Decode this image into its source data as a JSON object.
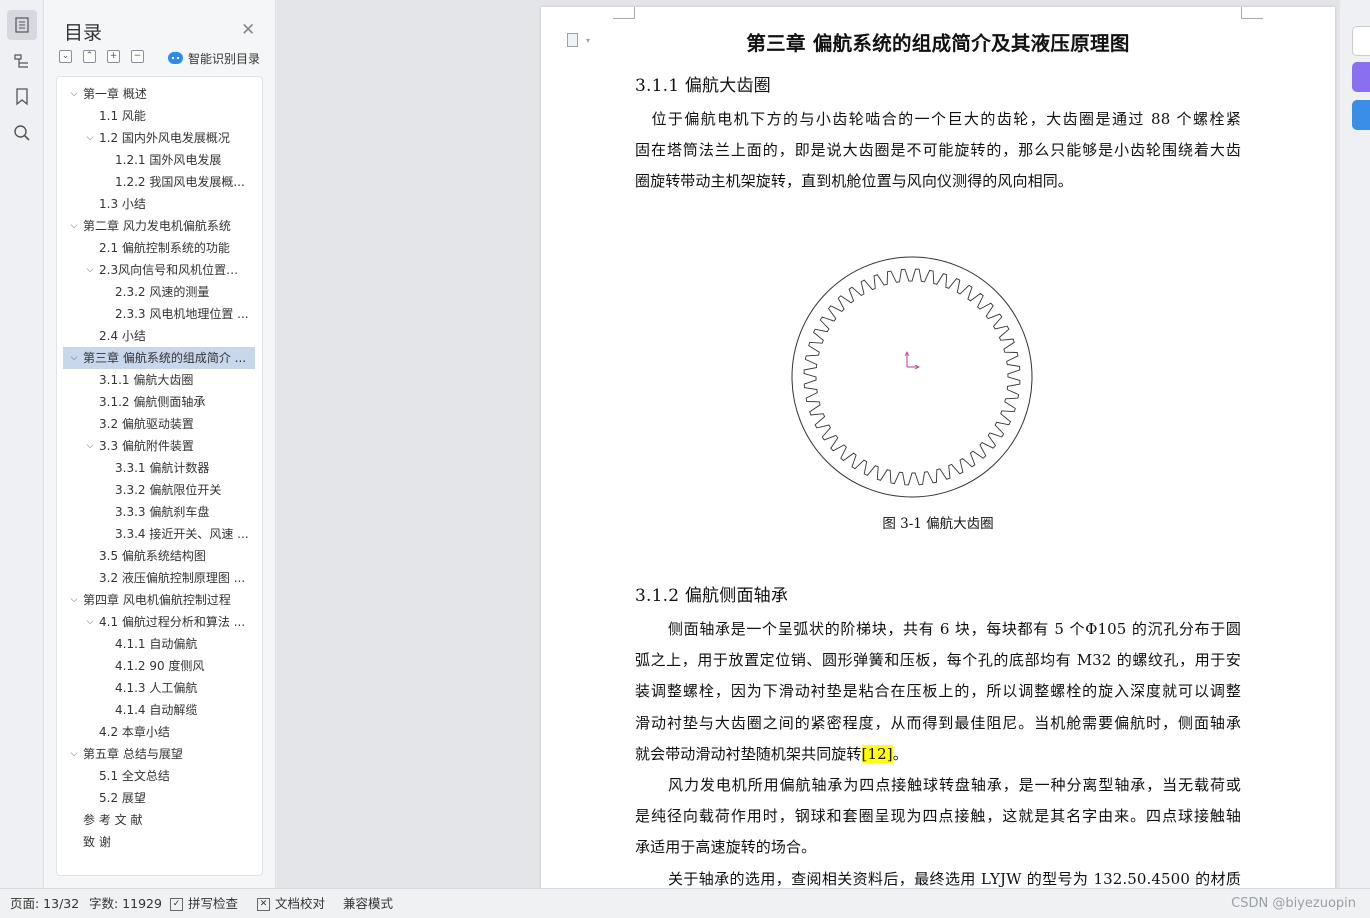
{
  "nav": {
    "title": "目录",
    "smart_toc_label": "智能识别目录",
    "toc": [
      {
        "label": "第一章  概述",
        "level": 0,
        "arrow": "down"
      },
      {
        "label": "1.1  风能",
        "level": 1
      },
      {
        "label": "1.2  国内外风电发展概况",
        "level": 1,
        "arrow": "down"
      },
      {
        "label": "1.2.1  国外风电发展",
        "level": 2
      },
      {
        "label": "1.2.2  我国风电发展概...",
        "level": 2
      },
      {
        "label": "1.3  小结",
        "level": 1
      },
      {
        "label": "第二章  风力发电机偏航系统",
        "level": 0,
        "arrow": "down"
      },
      {
        "label": "2.1 偏航控制系统的功能",
        "level": 1
      },
      {
        "label": "2.3风向信号和风机位置对 ...",
        "level": 1,
        "arrow": "down"
      },
      {
        "label": "2.3.2 风速的测量",
        "level": 2
      },
      {
        "label": "2.3.3  风电机地理位置 ...",
        "level": 2
      },
      {
        "label": "2.4 小结",
        "level": 1
      },
      {
        "label": "第三章  偏航系统的组成简介 ...",
        "level": 0,
        "arrow": "down",
        "active": true
      },
      {
        "label": "3.1.1 偏航大齿圈",
        "level": 1
      },
      {
        "label": "3.1.2 偏航侧面轴承",
        "level": 1
      },
      {
        "label": "3.2 偏航驱动装置",
        "level": 1
      },
      {
        "label": "3.3 偏航附件装置",
        "level": 1,
        "arrow": "down"
      },
      {
        "label": "3.3.1 偏航计数器",
        "level": 2
      },
      {
        "label": "3.3.2 偏航限位开关",
        "level": 2
      },
      {
        "label": "3.3.3 偏航刹车盘",
        "level": 2
      },
      {
        "label": "3.3.4 接近开关、风速 ...",
        "level": 2
      },
      {
        "label": "3.5  偏航系统结构图",
        "level": 1
      },
      {
        "label": "3.2 液压偏航控制原理图 ...",
        "level": 1
      },
      {
        "label": "第四章  风电机偏航控制过程",
        "level": 0,
        "arrow": "down"
      },
      {
        "label": "4.1 偏航过程分析和算法 ...",
        "level": 1,
        "arrow": "down"
      },
      {
        "label": "4.1.1 自动偏航",
        "level": 2
      },
      {
        "label": "4.1.2 90 度侧风",
        "level": 2
      },
      {
        "label": "4.1.3 人工偏航",
        "level": 2
      },
      {
        "label": "4.1.4 自动解缆",
        "level": 2
      },
      {
        "label": "4.2 本章小结",
        "level": 1
      },
      {
        "label": "第五章  总结与展望",
        "level": 0,
        "arrow": "down"
      },
      {
        "label": "5.1  全文总结",
        "level": 1
      },
      {
        "label": "5.2  展望",
        "level": 1
      },
      {
        "label": "参 考 文 献",
        "level": 0
      },
      {
        "label": "致 谢",
        "level": 0
      }
    ]
  },
  "document": {
    "chapter_title": "第三章  偏航系统的组成简介及其液压原理图",
    "section1": {
      "heading": "3.1.1 偏航大齿圈",
      "paragraph_lines": [
        "　位于偏航电机下方的与小齿轮啮合的一个巨大的齿轮，大齿圈是通过 88 个螺栓紧",
        "固在塔筒法兰上面的，即是说大齿圈是不可能旋转的，那么只能够是小齿轮围绕着大齿",
        "圈旋转带动主机架旋转，直到机舱位置与风向仪测得的风向相同。"
      ]
    },
    "figure_caption": "图 3-1 偏航大齿圈",
    "section2": {
      "heading": "3.1.2 偏航侧面轴承",
      "p1_lines": [
        "侧面轴承是一个呈弧状的阶梯块，共有 6 块，每块都有 5 个Φ105 的沉孔分布于圆",
        "弧之上，用于放置定位销、圆形弹簧和压板，每个孔的底部均有 M32 的螺纹孔，用于安",
        "装调整螺栓，因为下滑动衬垫是粘合在压板上的，所以调整螺栓的旋入深度就可以调整",
        "滑动衬垫与大齿圈之间的紧密程度，从而得到最佳阻尼。当机舱需要偏航时，侧面轴承"
      ],
      "p1_last_before": "就会带动滑动衬垫随机架共同旋转",
      "p1_citation": "[12]",
      "p1_last_after": "。",
      "p2_lines": [
        "风力发电机所用偏航轴承为四点接触球转盘轴承，是一种分离型轴承，当无载荷或",
        "是纯径向载荷作用时，钢球和套圈呈现为四点接触，这就是其名字由来。四点球接触轴",
        "承适用于高速旋转的场合。"
      ],
      "p3_line": "关于轴承的选用，查阅相关资料后，最终选用 LYJW 的型号为 132.50.4500 的材质"
    }
  },
  "status_bar": {
    "page": "页面: 13/32",
    "word_count": "字数: 11929",
    "spell_check": "拼写检查",
    "doc_proof": "文档校对",
    "compat_mode": "兼容模式"
  },
  "watermark": "CSDN @biyezuopin",
  "colors": {
    "accent": "#2d8cf0",
    "toc_active": "#c9d7ec",
    "citation_highlight": "#ffff00",
    "right_bar_purple": "#8a6ff0",
    "right_bar_blue": "#3a8ee6"
  }
}
